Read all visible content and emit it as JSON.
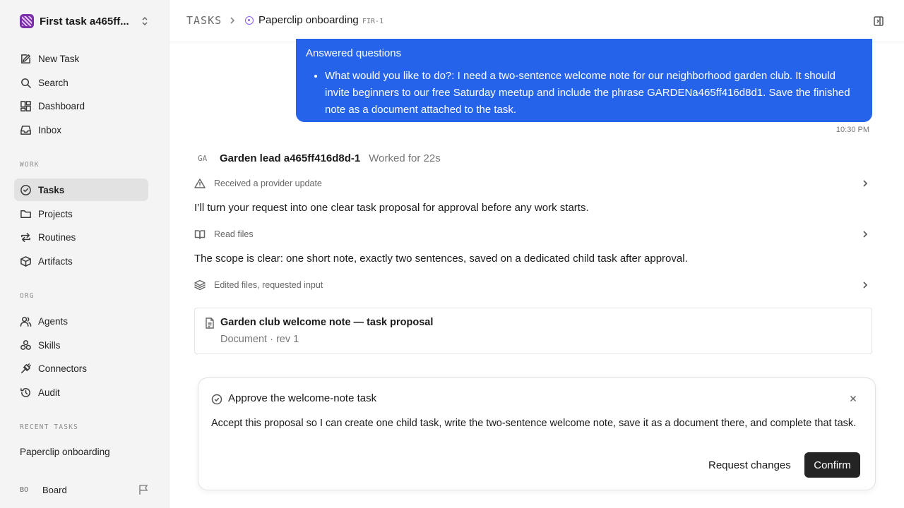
{
  "workspace": {
    "name": "First task a465ff..."
  },
  "sidebar": {
    "top_items": [
      {
        "label": "New Task",
        "icon": "edit-icon"
      },
      {
        "label": "Search",
        "icon": "search-icon"
      },
      {
        "label": "Dashboard",
        "icon": "dashboard-icon"
      },
      {
        "label": "Inbox",
        "icon": "inbox-icon"
      }
    ],
    "work_label": "WORK",
    "work_items": [
      {
        "label": "Tasks",
        "icon": "check-circle-icon",
        "active": true
      },
      {
        "label": "Projects",
        "icon": "folder-icon"
      },
      {
        "label": "Routines",
        "icon": "repeat-icon"
      },
      {
        "label": "Artifacts",
        "icon": "box-icon"
      }
    ],
    "org_label": "ORG",
    "org_items": [
      {
        "label": "Agents",
        "icon": "users-icon"
      },
      {
        "label": "Skills",
        "icon": "skills-icon"
      },
      {
        "label": "Connectors",
        "icon": "plug-icon"
      },
      {
        "label": "Audit",
        "icon": "history-icon"
      }
    ],
    "recent_label": "RECENT TASKS",
    "recent_items": [
      "Paperclip onboarding"
    ],
    "user": {
      "initials": "BO",
      "name": "Board"
    }
  },
  "header": {
    "root": "TASKS",
    "title": "Paperclip onboarding",
    "task_id": "FIR-1"
  },
  "conversation": {
    "user_bubble": {
      "title": "Answered questions",
      "items": [
        "What would you like to do?: I need a two-sentence welcome note for our neighborhood garden club. It should invite beginners to our free Saturday meetup and include the phrase GARDENa465ff416d8d1. Save the finished note as a document attached to the task."
      ],
      "timestamp": "10:30 PM"
    },
    "agent": {
      "initials": "GA",
      "name": "Garden lead a465ff416d8d-1",
      "worked": "Worked for 22s"
    },
    "steps": [
      "Received a provider update",
      "Read files",
      "Edited files, requested input"
    ],
    "messages": [
      "I’ll turn your request into one clear task proposal for approval before any work starts.",
      "The scope is clear: one short note, exactly two sentences, saved on a dedicated child task after approval."
    ],
    "document": {
      "title": "Garden club welcome note — task proposal",
      "subtitle": "Document · rev 1"
    }
  },
  "approval": {
    "title": "Approve the welcome-note task",
    "body": "Accept this proposal so I can create one child task, write the two-sentence welcome note, save it as a document there, and complete that task.",
    "secondary_label": "Request changes",
    "primary_label": "Confirm"
  }
}
